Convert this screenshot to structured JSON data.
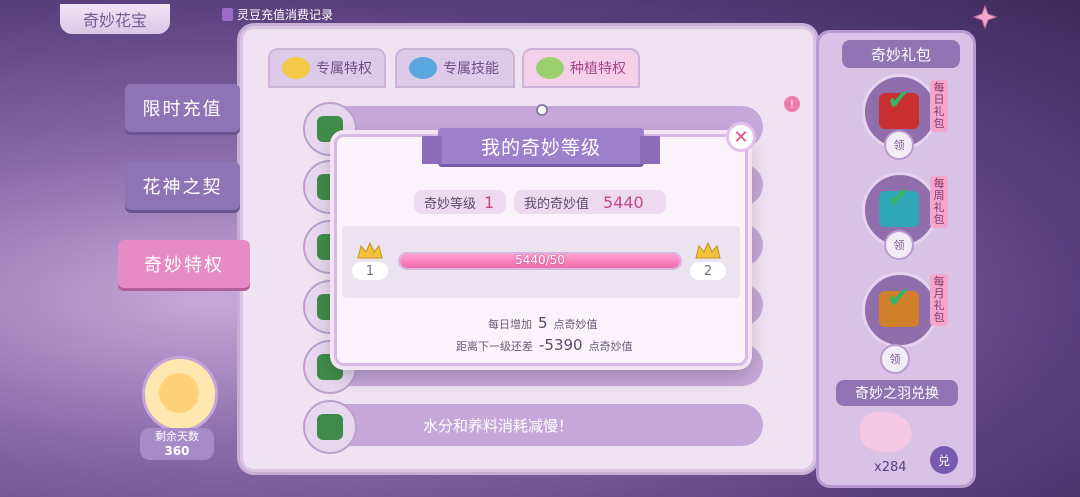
{
  "header": {
    "title": "奇妙花宝",
    "record_link": "灵豆充值消费记录"
  },
  "sidebar": {
    "items": [
      {
        "label": "限时充值"
      },
      {
        "label": "花神之契"
      },
      {
        "label": "奇妙特权",
        "active": true
      }
    ]
  },
  "tabs": [
    {
      "label": "专属特权"
    },
    {
      "label": "专属技能"
    },
    {
      "label": "种植特权",
      "active": true
    }
  ],
  "list": {
    "last_row_text": "水分和养料消耗减慢！"
  },
  "avatar": {
    "days_label": "剩余天数",
    "days_value": "360"
  },
  "gift_panel": {
    "title": "奇妙礼包",
    "gifts": [
      {
        "tag": "每日礼包",
        "claim": "领"
      },
      {
        "tag": "每周礼包",
        "claim": "领"
      },
      {
        "tag": "每月礼包",
        "claim": "领"
      }
    ],
    "feather_title": "奇妙之羽兑换",
    "feather_count": "x284",
    "exchange_label": "兑"
  },
  "modal": {
    "title": "我的奇妙等级",
    "level_label": "奇妙等级",
    "level_value": "1",
    "points_label": "我的奇妙值",
    "points_value": "5440",
    "current_level": "1",
    "next_level": "2",
    "progress_text": "5440/50",
    "progress_fraction": 1.0,
    "daily_prefix": "每日增加",
    "daily_value": "5",
    "daily_suffix": "点奇妙值",
    "next_prefix": "距离下一级还差",
    "next_value": "-5390",
    "next_suffix": "点奇妙值"
  },
  "colors": {
    "accent_pink": "#f26aad",
    "purple": "#9e7fcb",
    "value_pink": "#c4478d"
  }
}
